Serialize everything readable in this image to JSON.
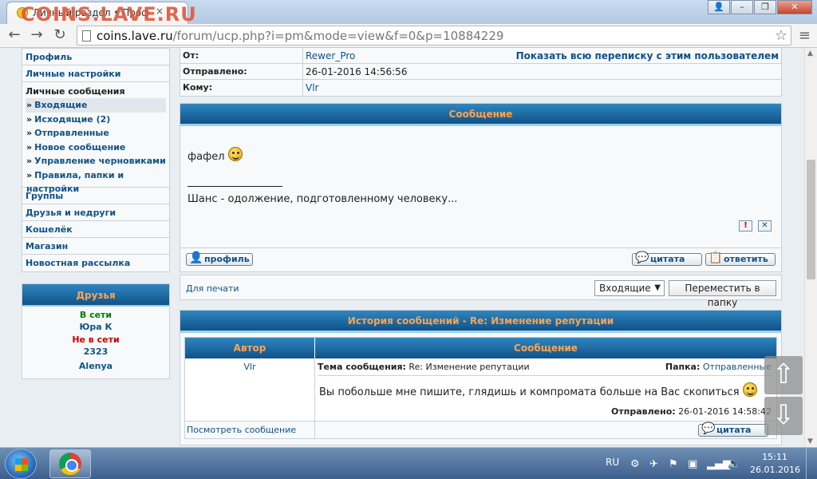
{
  "browser": {
    "tab_title": "Личный раздел • Проф",
    "tab_close": "×",
    "watermark": "COINS.LAVE.RU",
    "url_host": "coins.lave.ru",
    "url_rest": "/forum/ucp.php?i=pm&mode=view&f=0&p=10884229",
    "back": "←",
    "forward": "→",
    "reload": "↻",
    "star": "☆",
    "menu": "≡",
    "win_user": "👤",
    "win_min": "–",
    "win_max": "❐",
    "win_close": "✕"
  },
  "sidebar": {
    "items_top": [
      "Профиль",
      "Личные настройки"
    ],
    "pm_title": "Личные сообщения",
    "pm_items": [
      "Входящие",
      "Исходящие (2)",
      "Отправленные",
      "Новое сообщение",
      "Управление черновиками",
      "Правила, папки и настройки"
    ],
    "bullet": "»",
    "items_bottom": [
      "Группы",
      "Друзья и недруги",
      "Кошелёк",
      "Магазин",
      "Новостная рассылка"
    ]
  },
  "friends": {
    "title": "Друзья",
    "online_label": "В сети",
    "online": [
      "Юра К"
    ],
    "offline_label": "Не в сети",
    "offline": [
      "2323",
      "Alenya"
    ]
  },
  "header": {
    "from_label": "От:",
    "from_value": "Rewer_Pro",
    "show_all": "Показать всю переписку с этим пользователем",
    "sent_label": "Отправлено:",
    "sent_value": "26-01-2016 14:56:56",
    "to_label": "Кому:",
    "to_value": "Vlr"
  },
  "message": {
    "panel_title": "Сообщение",
    "text": "фафел",
    "signature": "Шанс - одолжение, подготовленному человеку...",
    "report": "!",
    "delete": "✕",
    "profile_btn": "профиль",
    "quote_btn": "цитата",
    "reply_btn": "ответить"
  },
  "actions": {
    "print": "Для печати",
    "folder_selected": "Входящие",
    "move_btn": "Переместить в папку"
  },
  "history": {
    "title": "История сообщений - Re: Изменение репутации",
    "col_author": "Автор",
    "col_message": "Сообщение",
    "author": "Vlr",
    "subject_label": "Тема сообщения:",
    "subject": "Re: Изменение репутации",
    "folder_label": "Папка:",
    "folder": "Отправленные",
    "text": "Вы побольше мне пишите, глядишь и компромата больше на Вас скопиться",
    "sent_label": "Отправлено:",
    "sent": "26-01-2016 14:58:42",
    "view_link": "Посмотреть сообщение",
    "quote_btn": "цитата"
  },
  "floating": {
    "up": "⇧",
    "down": "⇩"
  },
  "taskbar": {
    "lang": "RU",
    "time": "15:11",
    "date": "26.01.2016"
  }
}
